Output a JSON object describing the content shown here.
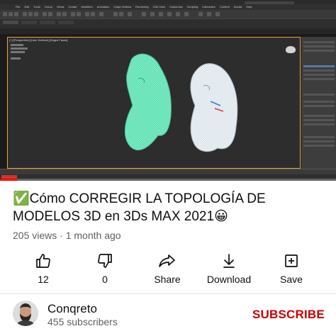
{
  "player": {
    "menu": [
      "File",
      "Edit",
      "Tools",
      "Group",
      "Views",
      "Create",
      "Modifiers",
      "Animation",
      "Graph Editors",
      "Rendering",
      "Civil View",
      "Customize",
      "Scripting",
      "Interactive",
      "Content",
      "Arnold",
      "Help"
    ],
    "viewport_label": "[+] [Perspective] [User Defined] [Edged Faces]",
    "progress_fraction": 0.05,
    "colors": {
      "accent": "#ff0000",
      "viewport_border": "#e6a33a",
      "mesh_green": "#5fe0b4",
      "mesh_white": "#e8f0f5"
    }
  },
  "video": {
    "title_icon": "✅",
    "title_text": "Cómo CORREGIR LA TOPOLOGÍA DE MODELOS 3D en 3Ds MAX 2021😀",
    "views": "205 views",
    "separator": " · ",
    "age": "1 month ago"
  },
  "actions": {
    "like": {
      "label": "12",
      "icon": "thumbs-up-icon"
    },
    "dislike": {
      "label": "0",
      "icon": "thumbs-down-icon"
    },
    "share": {
      "label": "Share",
      "icon": "share-arrow-icon"
    },
    "download": {
      "label": "Download",
      "icon": "download-arrow-icon"
    },
    "save": {
      "label": "Save",
      "icon": "playlist-add-icon"
    }
  },
  "channel": {
    "name": "Conqreto",
    "subscribers": "455 subscribers",
    "subscribe_label": "SUBSCRIBE",
    "subscribe_color": "#cc0000"
  }
}
